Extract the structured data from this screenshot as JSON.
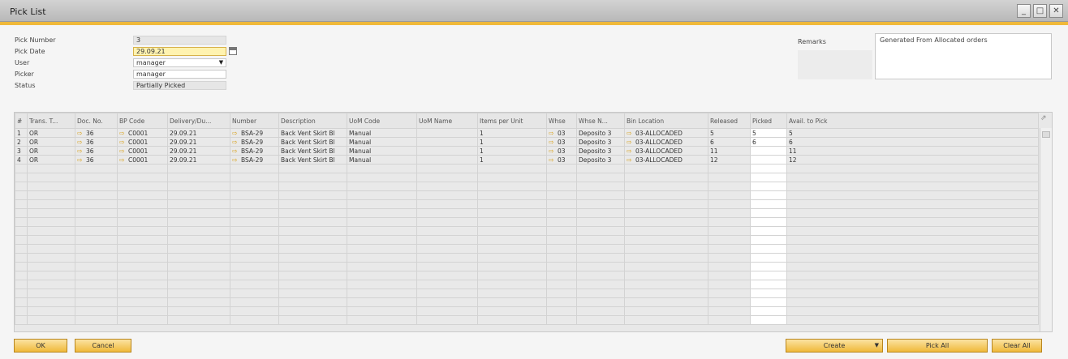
{
  "window": {
    "title": "Pick List"
  },
  "header": {
    "fields": [
      {
        "label": "Pick Number",
        "value": "3"
      },
      {
        "label": "Pick Date",
        "value": "29.09.21"
      },
      {
        "label": "User",
        "value": "manager"
      },
      {
        "label": "Picker",
        "value": "manager"
      },
      {
        "label": "Status",
        "value": "Partially Picked"
      }
    ],
    "remarks_label": "Remarks",
    "remarks_value": "Generated From Allocated orders"
  },
  "grid": {
    "columns": [
      "#",
      "Trans. T...",
      "Doc. No.",
      "BP Code",
      "Delivery/Du...",
      "Number",
      "Description",
      "UoM Code",
      "UoM Name",
      "Items per Unit",
      "Whse",
      "Whse N...",
      "Bin Location",
      "Released",
      "Picked",
      "Avail. to Pick"
    ],
    "rows": [
      [
        "1",
        "OR",
        "36",
        "C0001",
        "29.09.21",
        "BSA-29",
        "Back Vent Skirt Bl",
        "Manual",
        "",
        "1",
        "03",
        "Deposito 3",
        "03-ALLOCADED",
        "5",
        "5",
        "5"
      ],
      [
        "2",
        "OR",
        "36",
        "C0001",
        "29.09.21",
        "BSA-29",
        "Back Vent Skirt Bl",
        "Manual",
        "",
        "1",
        "03",
        "Deposito 3",
        "03-ALLOCADED",
        "6",
        "6",
        "6"
      ],
      [
        "3",
        "OR",
        "36",
        "C0001",
        "29.09.21",
        "BSA-29",
        "Back Vent Skirt Bl",
        "Manual",
        "",
        "1",
        "03",
        "Deposito 3",
        "03-ALLOCADED",
        "11",
        "",
        "11"
      ],
      [
        "4",
        "OR",
        "36",
        "C0001",
        "29.09.21",
        "BSA-29",
        "Back Vent Skirt Bl",
        "Manual",
        "",
        "1",
        "03",
        "Deposito 3",
        "03-ALLOCADED",
        "12",
        "",
        "12"
      ]
    ]
  },
  "buttons": {
    "ok": "OK",
    "cancel": "Cancel",
    "create": "Create",
    "pick_all": "Pick All",
    "clear_all": "Clear All"
  },
  "colors": {
    "accent": "#f0b93a",
    "link_arrow": "#d9a21c",
    "focus_field": "#fff3b0"
  }
}
